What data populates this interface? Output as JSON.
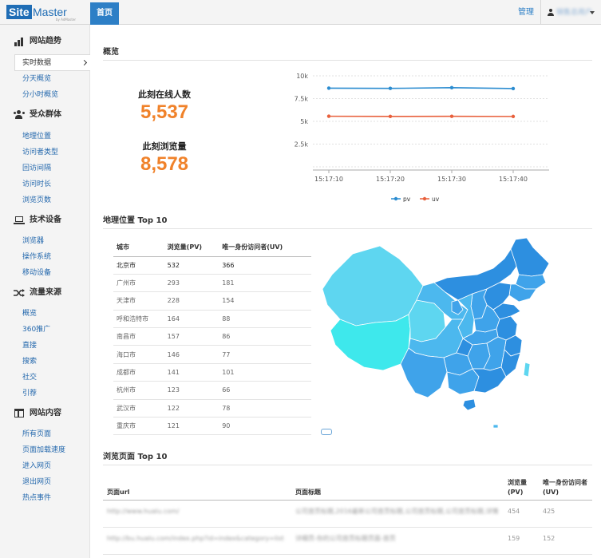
{
  "header": {
    "logo_box": "Site",
    "logo_rest": "Master",
    "logo_sub": "by AdMaster",
    "home_tab": "首页",
    "manage_link": "管理",
    "user_name": "销售总用户"
  },
  "sidebar": {
    "sections": [
      {
        "title": "网站趋势",
        "icon": "trend-icon",
        "items": [
          "实时数据",
          "分天概览",
          "分小时概览"
        ]
      },
      {
        "title": "受众群体",
        "icon": "group-icon",
        "items": [
          "地理位置",
          "访问者类型",
          "回访间隔",
          "访问时长",
          "浏览页数"
        ]
      },
      {
        "title": "技术设备",
        "icon": "laptop-icon",
        "items": [
          "浏览器",
          "操作系统",
          "移动设备"
        ]
      },
      {
        "title": "流量来源",
        "icon": "shuffle-icon",
        "items": [
          "概览",
          "360推广",
          "直接",
          "搜索",
          "社交",
          "引荐"
        ]
      },
      {
        "title": "网站内容",
        "icon": "layout-icon",
        "items": [
          "所有页面",
          "页面加载速度",
          "进入网页",
          "退出网页",
          "热点事件"
        ]
      }
    ],
    "active_item": "实时数据"
  },
  "overview": {
    "title": "概览",
    "online_label": "此刻在线人数",
    "online_value": "5,537",
    "views_label": "此刻浏览量",
    "views_value": "8,578"
  },
  "chart_data": {
    "type": "line",
    "x": [
      "15:17:10",
      "15:17:20",
      "15:17:30",
      "15:17:40"
    ],
    "series": [
      {
        "name": "pv",
        "values": [
          8650,
          8620,
          8700,
          8600
        ],
        "color": "#2b8cd0"
      },
      {
        "name": "uv",
        "values": [
          5560,
          5540,
          5550,
          5537
        ],
        "color": "#e8603c"
      }
    ],
    "yticks": [
      "10k",
      "7.5k",
      "5k",
      "2.5k"
    ],
    "ylim": [
      0,
      10000
    ],
    "grid": true,
    "legend": "bottom"
  },
  "geo": {
    "title": "地理位置 Top 10",
    "columns": [
      "城市",
      "浏览量(PV)",
      "唯一身份访问者(UV)"
    ],
    "rows": [
      [
        "北京市",
        "532",
        "366"
      ],
      [
        "广州市",
        "293",
        "181"
      ],
      [
        "天津市",
        "228",
        "154"
      ],
      [
        "呼和浩特市",
        "164",
        "88"
      ],
      [
        "南昌市",
        "157",
        "86"
      ],
      [
        "海口市",
        "146",
        "77"
      ],
      [
        "成都市",
        "141",
        "101"
      ],
      [
        "杭州市",
        "123",
        "66"
      ],
      [
        "武汉市",
        "122",
        "78"
      ],
      [
        "重庆市",
        "121",
        "90"
      ]
    ],
    "map_colors": [
      "#2d8fe0",
      "#3fa3ea",
      "#4cb8ee",
      "#5ed6f0",
      "#3ee8ec"
    ]
  },
  "pages": {
    "title": "浏览页面  Top 10",
    "columns": [
      "页面url",
      "页面标题",
      "浏览量 (PV)",
      "唯一身份访问者 (UV)"
    ],
    "rows": [
      [
        "http://www.hualu.com/",
        "公司首页标题,2016最新公司首页标题,公司首页标题,公司首页标题,详情",
        "454",
        "425"
      ],
      [
        "http://bu.hualu.com/index.php?id=index&category=list",
        "详细页-你的公司首页标题页面-首页",
        "159",
        "152"
      ]
    ]
  }
}
